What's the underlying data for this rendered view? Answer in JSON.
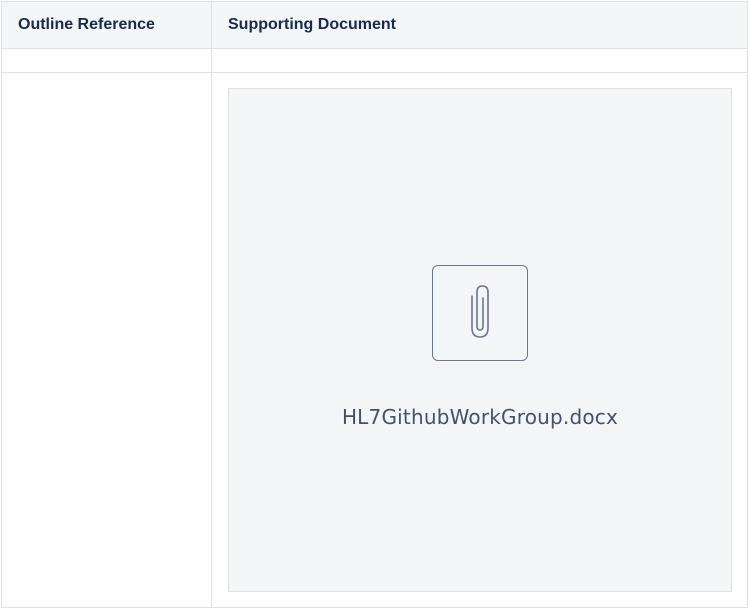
{
  "table": {
    "headers": [
      "Outline Reference",
      "Supporting Document"
    ],
    "rows": [
      {
        "outline_reference": "",
        "supporting_document": ""
      },
      {
        "outline_reference": "",
        "supporting_document": {
          "type": "attachment",
          "file_name": "HL7GithubWorkGroup.docx",
          "icon": "paperclip-icon"
        }
      }
    ]
  },
  "colors": {
    "header_bg": "#f4f5f7",
    "border": "#dfe1e6",
    "card_bg": "#f4f5f7",
    "icon_stroke": "#6b778c",
    "text": "#172b4d"
  }
}
